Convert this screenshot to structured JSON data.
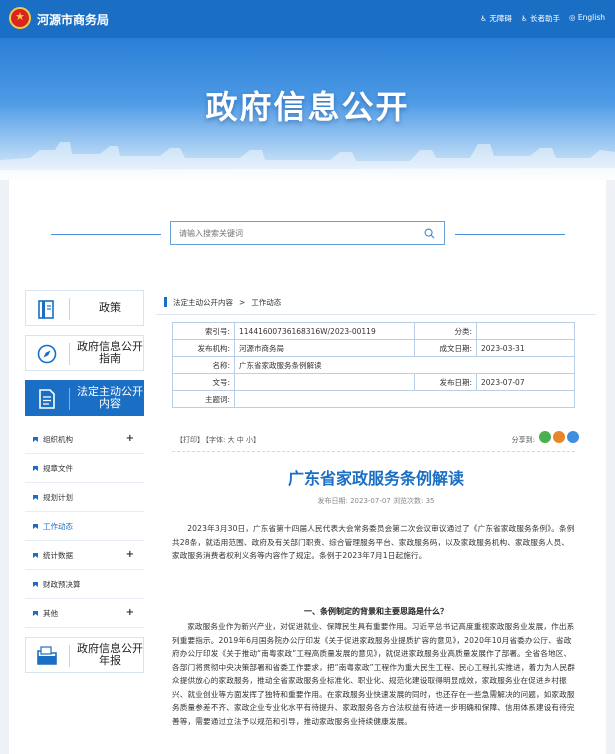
{
  "header": {
    "site_name": "河源市商务局",
    "tools": [
      "无障碍",
      "长者助手",
      "English"
    ]
  },
  "banner": {
    "title": "政府信息公开"
  },
  "search": {
    "placeholder": "请输入搜索关键词"
  },
  "sidebar": {
    "top_items": [
      {
        "label": "政策",
        "icon": "book-icon"
      },
      {
        "label": "政府信息公开指南",
        "icon": "compass-icon"
      },
      {
        "label": "法定主动公开内容",
        "icon": "document-icon",
        "active": true
      }
    ],
    "sub_items": [
      {
        "label": "组织机构",
        "expandable": true
      },
      {
        "label": "规章文件",
        "expandable": false
      },
      {
        "label": "规划计划",
        "expandable": false
      },
      {
        "label": "工作动态",
        "expandable": false,
        "current": true
      },
      {
        "label": "统计数据",
        "expandable": true
      },
      {
        "label": "财政预决算",
        "expandable": false
      },
      {
        "label": "其他",
        "expandable": true
      }
    ],
    "bottom_item": {
      "label": "政府信息公开年报",
      "icon": "folder-icon"
    }
  },
  "breadcrumb": [
    "法定主动公开内容",
    ">",
    "工作动态"
  ],
  "meta": {
    "index_no_label": "索引号:",
    "index_no": "11441600736168316W/2023-00119",
    "category_label": "分类:",
    "category": "",
    "publisher_label": "发布机构:",
    "publisher": "河源市商务局",
    "date_made_label": "成文日期:",
    "date_made": "2023-03-31",
    "name_label": "名称:",
    "name": "广东省家政服务条例解读",
    "doc_no_label": "文号:",
    "doc_no": "",
    "pub_date_label": "发布日期:",
    "pub_date": "2023-07-07",
    "subject_label": "主题词:",
    "subject": ""
  },
  "toolbar": {
    "print": "【打印】",
    "font": "【字体: 大 中 小】",
    "share_label": "分享到:"
  },
  "article": {
    "title": "广东省家政服务条例解读",
    "info": "发布日期: 2023-07-07  浏览次数: 35",
    "para1": "2023年3月30日，广东省第十四届人民代表大会常务委员会第二次会议审议通过了《广东省家政服务条例》。条例共28条，就适用范围、政府及有关部门职责、综合管理服务平台、家政服务码，以及家政服务机构、家政服务人员、家政服务消费者权利义务等内容作了规定。条例于2023年7月1日起施行。",
    "h1": "一、条例制定的背景和主要思路是什么？",
    "para2": "家政服务业作为新兴产业，对促进就业、保障民生具有重要作用。习近平总书记高度重视家政服务业发展，作出系列重要指示。2019年6月国务院办公厅印发《关于促进家政服务业提质扩容的意见》，2020年10月省委办公厅、省政府办公厅印发《关于推动“南粤家政”工程高质量发展的意见》，就促进家政服务业高质量发展作了部署。全省各地区、各部门将贯彻中央决策部署和省委工作要求，把“南粤家政”工程作为重大民生工程、民心工程扎实推进，着力为人民群众提供放心的家政服务，推动全省家政服务业标准化、职业化、规范化建设取得明显成效，家政服务业在促进乡村振兴、就业创业等方面发挥了独特和重要作用。在家政服务业快速发展的同时，也还存在一些急需解决的问题，如家政服务质量参差不齐、家政企业专业化水平有待提升、家政服务各方合法权益有待进一步明确和保障、信用体系建设有待完善等，需要通过立法予以规范和引导，推动家政服务业持续健康发展。"
  }
}
